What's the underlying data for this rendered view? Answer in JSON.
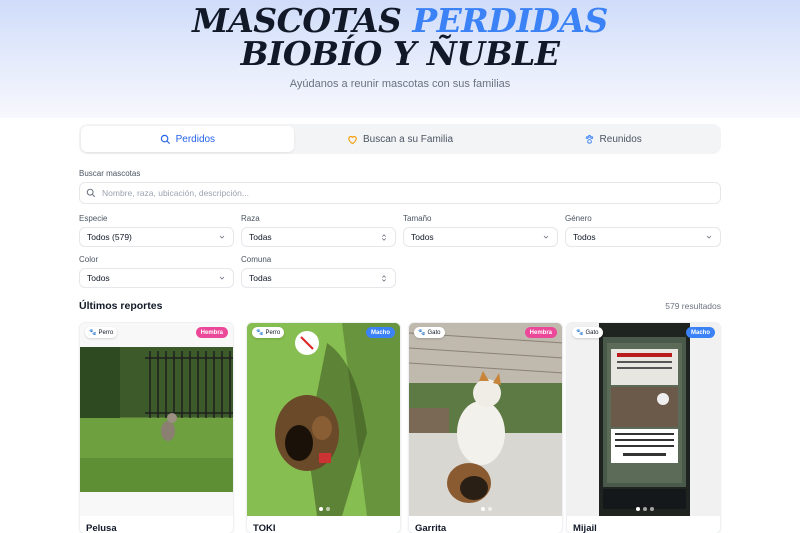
{
  "hero": {
    "title_line1_a": "MASCOTAS ",
    "title_line1_b": "PERDIDAS",
    "title_line2": "BIOBÍO Y ÑUBLE",
    "subtitle": "Ayúdanos a reunir mascotas con sus familias",
    "accent_color": "#3b82f6"
  },
  "tabs": [
    {
      "label": "Perdidos",
      "icon": "search-icon",
      "active": true
    },
    {
      "label": "Buscan a su Familia",
      "icon": "heart-icon",
      "active": false
    },
    {
      "label": "Reunidos",
      "icon": "paw-icon",
      "active": false
    }
  ],
  "search": {
    "label": "Buscar mascotas",
    "placeholder": "Nombre, raza, ubicación, descripción...",
    "value": ""
  },
  "filters": {
    "especie": {
      "label": "Especie",
      "value": "Todos (579)"
    },
    "raza": {
      "label": "Raza",
      "value": "Todas"
    },
    "tamano": {
      "label": "Tamaño",
      "value": "Todos"
    },
    "genero": {
      "label": "Género",
      "value": "Todos"
    },
    "color": {
      "label": "Color",
      "value": "Todos"
    },
    "comuna": {
      "label": "Comuna",
      "value": "Todas"
    }
  },
  "results": {
    "title": "Últimos reportes",
    "count_text": "579 resultados"
  },
  "cards": [
    {
      "name": "Pelusa",
      "species": "Perro",
      "sex": "Hembra",
      "sex_color": "#ec4899"
    },
    {
      "name": "TOKI",
      "species": "Perro",
      "sex": "Macho",
      "sex_color": "#3b82f6"
    },
    {
      "name": "Garrita",
      "species": "Gato",
      "sex": "Hembra",
      "sex_color": "#ec4899"
    },
    {
      "name": "Mijail",
      "species": "Gato",
      "sex": "Macho",
      "sex_color": "#3b82f6"
    }
  ]
}
